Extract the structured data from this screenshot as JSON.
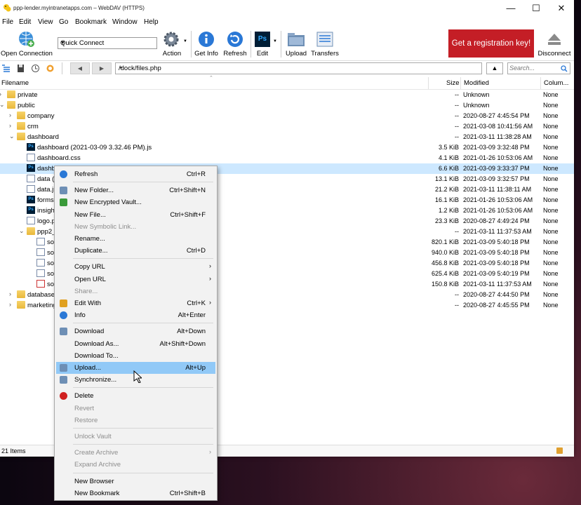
{
  "window": {
    "title": "ppp-lender.myintranetapps.com – WebDAV (HTTPS)",
    "controls": [
      "—",
      "☐",
      "✕"
    ]
  },
  "menubar": [
    "File",
    "Edit",
    "View",
    "Go",
    "Bookmark",
    "Window",
    "Help"
  ],
  "toolbar": {
    "open_connection": "Open Connection",
    "quick_connect": "Quick Connect",
    "action": "Action",
    "get_info": "Get Info",
    "refresh": "Refresh",
    "edit": "Edit",
    "upload": "Upload",
    "transfers": "Transfers",
    "registration": "Get a registration key!",
    "disconnect": "Disconnect"
  },
  "pathbar": {
    "path": "/dock/files.php",
    "search_placeholder": "Search..."
  },
  "columns": {
    "filename": "Filename",
    "size": "Size",
    "modified": "Modified",
    "column": "Colum..."
  },
  "files": [
    {
      "name": "private",
      "size": "--",
      "modified": "Unknown",
      "col": "None",
      "type": "folder",
      "level": 0,
      "expander": "closed"
    },
    {
      "name": "public",
      "size": "--",
      "modified": "Unknown",
      "col": "None",
      "type": "folder",
      "level": 0,
      "expander": "open"
    },
    {
      "name": "company",
      "size": "--",
      "modified": "2020-08-27 4:45:54 PM",
      "col": "None",
      "type": "folder",
      "level": 1,
      "expander": "closed"
    },
    {
      "name": "crm",
      "size": "--",
      "modified": "2021-03-08 10:41:56 AM",
      "col": "None",
      "type": "folder",
      "level": 1,
      "expander": "closed"
    },
    {
      "name": "dashboard",
      "size": "--",
      "modified": "2021-03-11 11:38:28 AM",
      "col": "None",
      "type": "folder",
      "level": 1,
      "expander": "open"
    },
    {
      "name": "dashboard (2021-03-09 3.32.46 PM).js",
      "size": "3.5 KiB",
      "modified": "2021-03-09 3:32:48 PM",
      "col": "None",
      "type": "ps",
      "level": 2,
      "expander": ""
    },
    {
      "name": "dashboard.css",
      "size": "4.1 KiB",
      "modified": "2021-01-26 10:53:06 AM",
      "col": "None",
      "type": "doc",
      "level": 2,
      "expander": ""
    },
    {
      "name": "dashb",
      "size": "6.6 KiB",
      "modified": "2021-03-09 3:33:37 PM",
      "col": "None",
      "type": "ps",
      "level": 2,
      "expander": "",
      "selected": true
    },
    {
      "name": "data (2",
      "size": "13.1 KiB",
      "modified": "2021-03-09 3:32:57 PM",
      "col": "None",
      "type": "doc",
      "level": 2,
      "expander": ""
    },
    {
      "name": "data.js",
      "size": "21.2 KiB",
      "modified": "2021-03-11 11:38:11 AM",
      "col": "None",
      "type": "doc",
      "level": 2,
      "expander": ""
    },
    {
      "name": "forms.",
      "size": "16.1 KiB",
      "modified": "2021-01-26 10:53:06 AM",
      "col": "None",
      "type": "ps",
      "level": 2,
      "expander": ""
    },
    {
      "name": "insight",
      "size": "1.2 KiB",
      "modified": "2021-01-26 10:53:06 AM",
      "col": "None",
      "type": "ps",
      "level": 2,
      "expander": ""
    },
    {
      "name": "logo.p",
      "size": "23.3 KiB",
      "modified": "2020-08-27 4:49:24 PM",
      "col": "None",
      "type": "doc",
      "level": 2,
      "expander": ""
    },
    {
      "name": "ppp2_",
      "size": "--",
      "modified": "2021-03-11 11:37:53 AM",
      "col": "None",
      "type": "folder",
      "level": 2,
      "expander": "open"
    },
    {
      "name": "sou",
      "size": "820.1 KiB",
      "modified": "2021-03-09 5:40:18 PM",
      "col": "None",
      "type": "doc",
      "level": 3,
      "expander": ""
    },
    {
      "name": "sou",
      "size": "940.0 KiB",
      "modified": "2021-03-09 5:40:18 PM",
      "col": "None",
      "type": "doc",
      "level": 3,
      "expander": ""
    },
    {
      "name": "sou",
      "size": "456.8 KiB",
      "modified": "2021-03-09 5:40:18 PM",
      "col": "None",
      "type": "doc",
      "level": 3,
      "expander": ""
    },
    {
      "name": "sou",
      "size": "625.4 KiB",
      "modified": "2021-03-09 5:40:19 PM",
      "col": "None",
      "type": "doc",
      "level": 3,
      "expander": ""
    },
    {
      "name": "sou",
      "size": "150.8 KiB",
      "modified": "2021-03-11 11:37:53 AM",
      "col": "None",
      "type": "pdf",
      "level": 3,
      "expander": ""
    },
    {
      "name": "database",
      "size": "--",
      "modified": "2020-08-27 4:44:50 PM",
      "col": "None",
      "type": "folder",
      "level": 1,
      "expander": "closed"
    },
    {
      "name": "marketing",
      "size": "--",
      "modified": "2020-08-27 4:45:55 PM",
      "col": "None",
      "type": "folder",
      "level": 1,
      "expander": "closed"
    }
  ],
  "status": {
    "count": "21 Items"
  },
  "context_menu": [
    {
      "label": "Refresh",
      "shortcut": "Ctrl+R",
      "icon": "refresh-icon",
      "color": "#2a78d6"
    },
    {
      "sep": true
    },
    {
      "label": "New Folder...",
      "shortcut": "Ctrl+Shift+N",
      "icon": "new-folder-icon",
      "color": "#6e8fb5"
    },
    {
      "label": "New Encrypted Vault...",
      "shortcut": "",
      "icon": "vault-icon",
      "color": "#3a9a3a"
    },
    {
      "label": "New File...",
      "shortcut": "Ctrl+Shift+F",
      "icon": "",
      "color": ""
    },
    {
      "label": "New Symbolic Link...",
      "shortcut": "",
      "icon": "",
      "color": "",
      "disabled": true
    },
    {
      "label": "Rename...",
      "shortcut": "",
      "icon": "",
      "color": ""
    },
    {
      "label": "Duplicate...",
      "shortcut": "Ctrl+D",
      "icon": "",
      "color": ""
    },
    {
      "sep": true
    },
    {
      "label": "Copy URL",
      "shortcut": "",
      "icon": "",
      "color": "",
      "submenu": true
    },
    {
      "label": "Open URL",
      "shortcut": "",
      "icon": "",
      "color": "",
      "submenu": true
    },
    {
      "label": "Share...",
      "shortcut": "",
      "icon": "",
      "color": "",
      "disabled": true
    },
    {
      "label": "Edit With",
      "shortcut": "Ctrl+K",
      "icon": "pencil-icon",
      "color": "#e0a020",
      "submenu": true
    },
    {
      "label": "Info",
      "shortcut": "Alt+Enter",
      "icon": "info-icon",
      "color": "#2a78d6"
    },
    {
      "sep": true
    },
    {
      "label": "Download",
      "shortcut": "Alt+Down",
      "icon": "download-icon",
      "color": "#6e8fb5"
    },
    {
      "label": "Download As...",
      "shortcut": "Alt+Shift+Down",
      "icon": "",
      "color": ""
    },
    {
      "label": "Download To...",
      "shortcut": "",
      "icon": "",
      "color": ""
    },
    {
      "label": "Upload...",
      "shortcut": "Alt+Up",
      "icon": "upload-icon",
      "color": "#6e8fb5",
      "hover": true
    },
    {
      "label": "Synchronize...",
      "shortcut": "",
      "icon": "sync-icon",
      "color": "#6e8fb5"
    },
    {
      "sep": true
    },
    {
      "label": "Delete",
      "shortcut": "",
      "icon": "delete-icon",
      "color": "#d02020"
    },
    {
      "label": "Revert",
      "shortcut": "",
      "icon": "",
      "color": "",
      "disabled": true
    },
    {
      "label": "Restore",
      "shortcut": "",
      "icon": "",
      "color": "",
      "disabled": true
    },
    {
      "sep": true
    },
    {
      "label": "Unlock Vault",
      "shortcut": "",
      "icon": "",
      "color": "",
      "disabled": true
    },
    {
      "sep": true
    },
    {
      "label": "Create Archive",
      "shortcut": "",
      "icon": "",
      "color": "",
      "disabled": true,
      "submenu": true
    },
    {
      "label": "Expand Archive",
      "shortcut": "",
      "icon": "",
      "color": "",
      "disabled": true
    },
    {
      "sep": true
    },
    {
      "label": "New Browser",
      "shortcut": "",
      "icon": "",
      "color": ""
    },
    {
      "label": "New Bookmark",
      "shortcut": "Ctrl+Shift+B",
      "icon": "",
      "color": ""
    }
  ]
}
